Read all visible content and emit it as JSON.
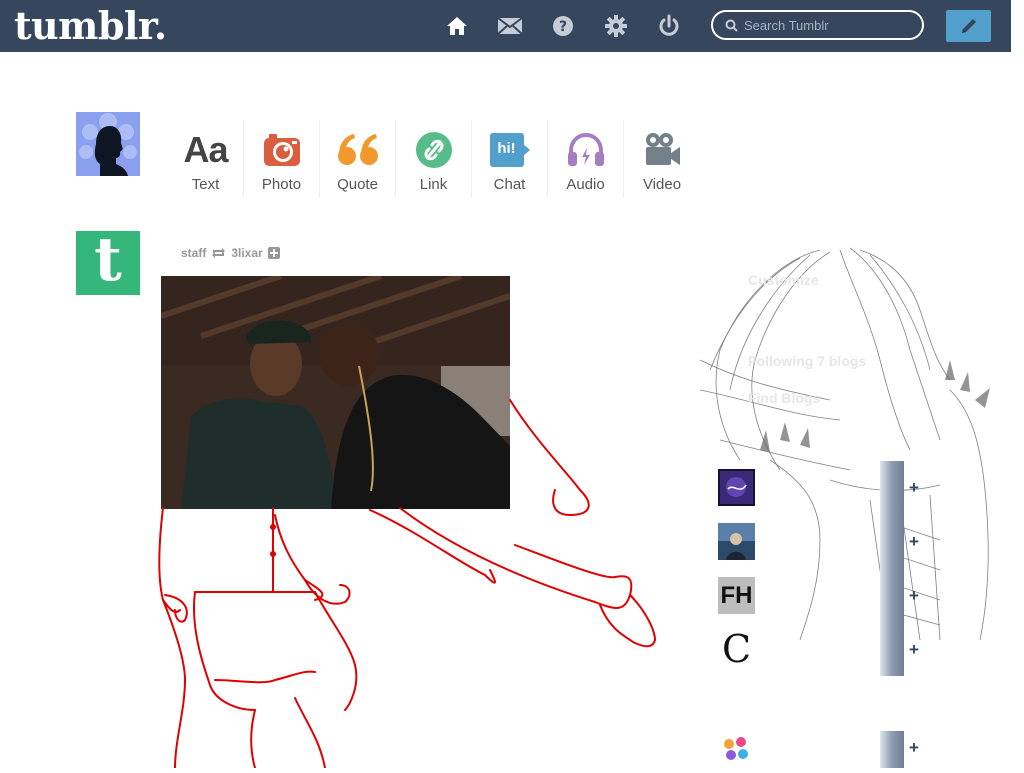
{
  "header": {
    "logo_text": "tumblr.",
    "bar_color": "#36465d",
    "nav_icons": [
      "home-icon",
      "mail-icon",
      "help-icon",
      "gear-icon",
      "power-icon"
    ],
    "search_placeholder": "Search Tumblr",
    "compose_icon": "pencil-icon",
    "compose_color": "#529ecc"
  },
  "post_types": [
    {
      "label": "Text",
      "icon": "text-icon",
      "color": "#444444",
      "glyph": "Aa"
    },
    {
      "label": "Photo",
      "icon": "camera-icon",
      "color": "#d95e40"
    },
    {
      "label": "Quote",
      "icon": "quote-icon",
      "color": "#f2992e",
      "glyph": "66"
    },
    {
      "label": "Link",
      "icon": "link-icon",
      "color": "#56bc8a"
    },
    {
      "label": "Chat",
      "icon": "chat-icon",
      "color": "#529ecc",
      "glyph": "hi!"
    },
    {
      "label": "Audio",
      "icon": "headphones-icon",
      "color": "#a77dc2"
    },
    {
      "label": "Video",
      "icon": "video-camera-icon",
      "color": "#748089"
    }
  ],
  "post": {
    "author": "staff",
    "reblog_icon": "reblog-icon",
    "reblogged_from": "3lixar",
    "follow_icon": "plus-icon",
    "avatar_glyph": "t",
    "avatar_color": "#35b77b"
  },
  "sidebar": {
    "links": [
      "Customize",
      "Following 7 blogs",
      "Find Blogs"
    ],
    "recommended": [
      {
        "thumb_text": "",
        "icon": "blog-avatar-icon"
      },
      {
        "thumb_text": "",
        "icon": "blog-avatar-icon"
      },
      {
        "thumb_text": "FH",
        "icon": "blog-avatar-icon"
      },
      {
        "thumb_text": "C",
        "icon": "blog-avatar-icon"
      },
      {
        "thumb_text": "",
        "icon": "blog-avatar-icon"
      }
    ],
    "follow_label": "+"
  }
}
